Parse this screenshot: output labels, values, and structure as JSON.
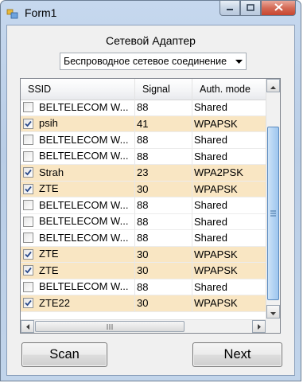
{
  "window": {
    "title": "Form1",
    "icon": "app-form-icon",
    "controls": [
      "minimize-icon",
      "maximize-icon",
      "close-icon"
    ]
  },
  "adapter": {
    "label": "Сетевой Адаптер",
    "selected": "Беспроводное сетевое соединение"
  },
  "grid": {
    "columns": [
      "SSID",
      "Signal",
      "Auth. mode"
    ],
    "rows": [
      {
        "checked": false,
        "ssid": "BELTELECOM W...",
        "signal": "88",
        "auth": "Shared",
        "highlight": false
      },
      {
        "checked": true,
        "ssid": "psih",
        "signal": "41",
        "auth": "WPAPSK",
        "highlight": true
      },
      {
        "checked": false,
        "ssid": "BELTELECOM W...",
        "signal": "88",
        "auth": "Shared",
        "highlight": false
      },
      {
        "checked": false,
        "ssid": "BELTELECOM W...",
        "signal": "88",
        "auth": "Shared",
        "highlight": false
      },
      {
        "checked": true,
        "ssid": "Strah",
        "signal": "23",
        "auth": "WPA2PSK",
        "highlight": true
      },
      {
        "checked": true,
        "ssid": "ZTE",
        "signal": "30",
        "auth": "WPAPSK",
        "highlight": true
      },
      {
        "checked": false,
        "ssid": "BELTELECOM W...",
        "signal": "88",
        "auth": "Shared",
        "highlight": false
      },
      {
        "checked": false,
        "ssid": "BELTELECOM W...",
        "signal": "88",
        "auth": "Shared",
        "highlight": false
      },
      {
        "checked": false,
        "ssid": "BELTELECOM W...",
        "signal": "88",
        "auth": "Shared",
        "highlight": false
      },
      {
        "checked": true,
        "ssid": "ZTE",
        "signal": "30",
        "auth": "WPAPSK",
        "highlight": true
      },
      {
        "checked": true,
        "ssid": "ZTE",
        "signal": "30",
        "auth": "WPAPSK",
        "highlight": true
      },
      {
        "checked": false,
        "ssid": "BELTELECOM W...",
        "signal": "88",
        "auth": "Shared",
        "highlight": false
      },
      {
        "checked": true,
        "ssid": "ZTE22",
        "signal": "30",
        "auth": "WPAPSK",
        "highlight": true
      }
    ]
  },
  "buttons": {
    "scan": "Scan",
    "next": "Next"
  },
  "colors": {
    "highlight_row": "#f9e6c3",
    "scroll_thumb": "#b3d3f3"
  }
}
